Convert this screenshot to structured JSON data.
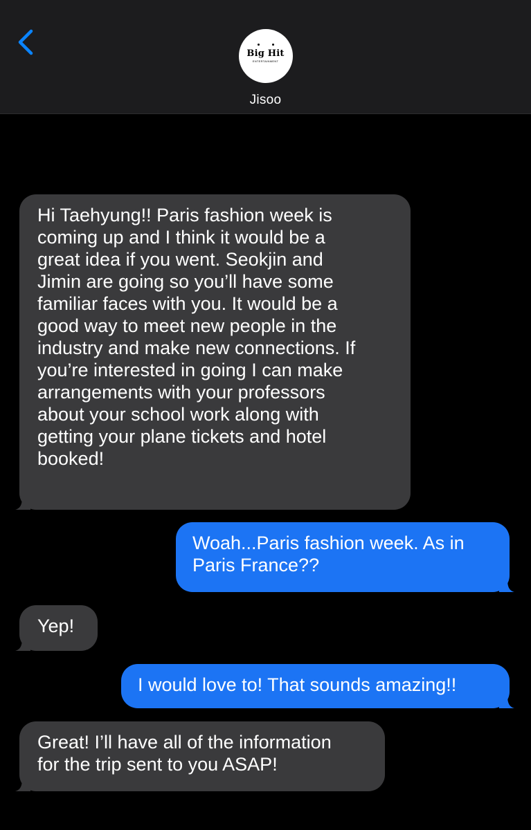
{
  "header": {
    "contact_name": "Jisoo",
    "avatar": {
      "logo_main": "Big Hit",
      "logo_sub": "ENTERTAINMENT"
    },
    "back_icon": "chevron-left-icon",
    "accent_color": "#0a84ff"
  },
  "colors": {
    "incoming_bubble": "#3a3a3c",
    "outgoing_bubble": "#1c74f4",
    "background": "#000000",
    "header_background": "#1c1c1e"
  },
  "messages": [
    {
      "direction": "incoming",
      "lines": [
        "Hi Taehyung!! Paris fashion week is",
        "coming up and I think it would be a",
        "great idea if you went. Seokjin and",
        "Jimin are going so you’ll have some",
        "familiar faces with you. It would be a",
        "good way to meet new people in the",
        "industry and make new connections. If",
        "you’re interested in going I can make",
        "arrangements with your professors",
        "about your school work along with",
        "getting your plane tickets and hotel",
        "booked!"
      ]
    },
    {
      "direction": "outgoing",
      "lines": [
        "Woah...Paris fashion week. As in",
        "Paris France??"
      ]
    },
    {
      "direction": "incoming",
      "lines": [
        "Yep!"
      ]
    },
    {
      "direction": "outgoing",
      "lines": [
        "I would love to! That sounds amazing!!"
      ]
    },
    {
      "direction": "incoming",
      "lines": [
        "Great! I’ll have all of the information",
        "for the trip sent to you ASAP!"
      ]
    }
  ]
}
